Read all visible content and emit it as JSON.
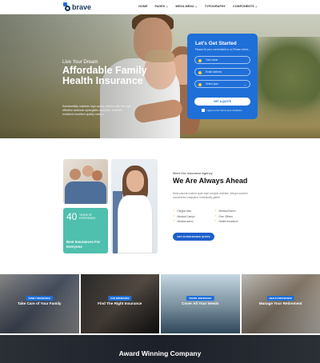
{
  "header": {
    "logo_text": "brave",
    "nav": [
      "HOME",
      "PAGES ⌄",
      "MEGA MENU ⌄",
      "TYPOGRAPHY",
      "COMPONENTS ⌄"
    ]
  },
  "hero": {
    "subtitle": "Live Your Dream",
    "title": "Affordable Family Health Insurance",
    "description": "Substantially maintain high quality metrics with the cost effective whereas synergistic expertise. Maintain excellent excellent quality metrics."
  },
  "quote_form": {
    "title": "Let's Get Started",
    "subtitle": "Please let your comfortable to us Please select...",
    "fields": [
      {
        "placeholder": "Your name",
        "icon": "user-icon"
      },
      {
        "placeholder": "Email address",
        "icon": "mail-icon"
      },
      {
        "placeholder": "Select plan",
        "icon": "list-icon"
      }
    ],
    "button_label": "GET A QUOTE",
    "agree_text": "I agree to the Terms and conditions"
  },
  "about": {
    "experience_number": "40",
    "experience_label": "YEARS OF EXPERIENCE",
    "experience_title": "Best Insurances For Everyone",
    "kicker": "Meet Our Insurance Agency",
    "title": "We Are Always Ahead",
    "description": "Dicta placeat nostrud quae eget volutpat molestie. Integra summer consectetur integrated. Individually gather.",
    "features": [
      "Fatigue Man",
      "Medical Earnin",
      "Medical Camps",
      "Free Offices",
      "Medical aaron",
      "Health Insurance"
    ],
    "button_label": "GET AN INSURANCE QUOTE"
  },
  "services": [
    {
      "tag": "FAMILY INSURANCE",
      "label": "Take Care of Your Family"
    },
    {
      "tag": "CAR INSURANCE",
      "label": "Find The Right Insurance"
    },
    {
      "tag": "TRAVEL INSURANCE",
      "label": "Cover All Your Needs"
    },
    {
      "tag": "HEALTH INSURANCE",
      "label": "Manage Your Retirement"
    }
  ],
  "award": {
    "title": "Award Winning Company"
  },
  "colors": {
    "primary": "#1f6fd8",
    "teal": "#4fbfae",
    "navy": "#17365c",
    "accent": "#f2a900"
  }
}
